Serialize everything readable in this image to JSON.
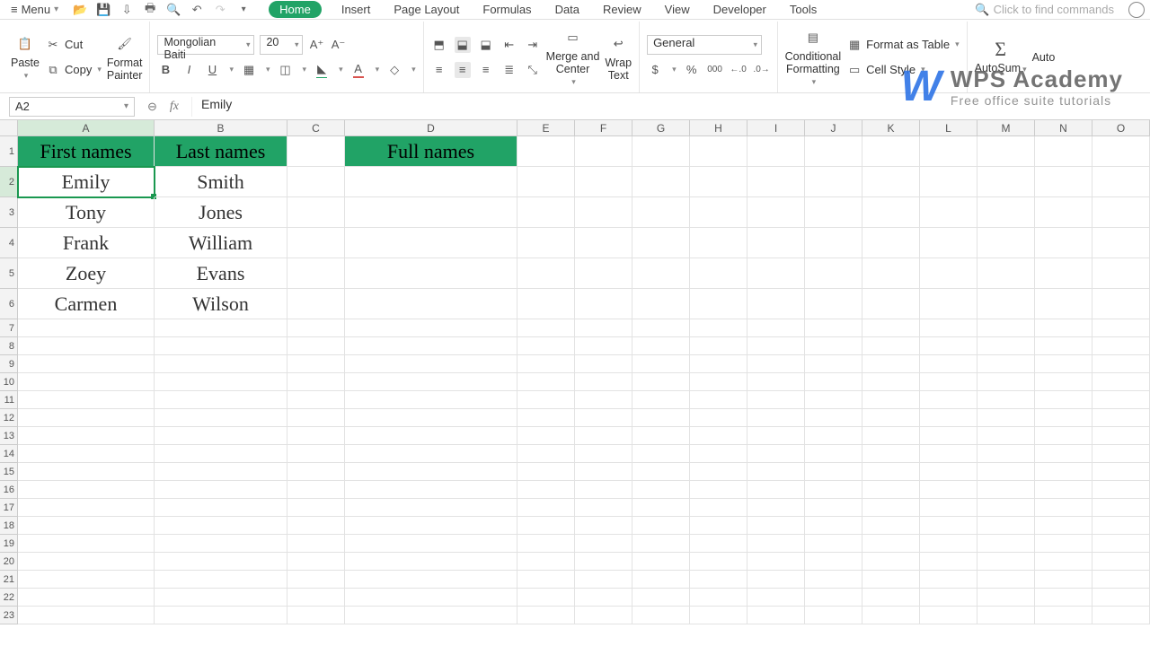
{
  "menu_label": "Menu",
  "tabs": {
    "home": "Home",
    "insert": "Insert",
    "page_layout": "Page Layout",
    "formulas": "Formulas",
    "data": "Data",
    "review": "Review",
    "view": "View",
    "developer": "Developer",
    "tools": "Tools"
  },
  "search_placeholder": "Click to find commands",
  "ribbon": {
    "paste": "Paste",
    "cut": "Cut",
    "copy": "Copy",
    "format_painter": "Format\nPainter",
    "font_name": "Mongolian Baiti",
    "font_size": "20",
    "merge_center": "Merge and\nCenter",
    "wrap_text": "Wrap\nText",
    "number_format": "General",
    "conditional_formatting": "Conditional\nFormatting",
    "format_as_table": "Format as Table",
    "cell_style": "Cell Style",
    "autosum": "AutoSum",
    "auto_partial": "Auto"
  },
  "name_box": "A2",
  "formula_value": "Emily",
  "columns": [
    {
      "id": "A",
      "w": 152
    },
    {
      "id": "B",
      "w": 148
    },
    {
      "id": "C",
      "w": 64
    },
    {
      "id": "D",
      "w": 192
    },
    {
      "id": "E",
      "w": 64
    },
    {
      "id": "F",
      "w": 64
    },
    {
      "id": "G",
      "w": 64
    },
    {
      "id": "H",
      "w": 64
    },
    {
      "id": "I",
      "w": 64
    },
    {
      "id": "J",
      "w": 64
    },
    {
      "id": "K",
      "w": 64
    },
    {
      "id": "L",
      "w": 64
    },
    {
      "id": "M",
      "w": 64
    },
    {
      "id": "N",
      "w": 64
    },
    {
      "id": "O",
      "w": 64
    }
  ],
  "row_heights": {
    "tall_rows": 6,
    "tall_h": 34,
    "short_h": 20,
    "total_rows": 23
  },
  "cells": {
    "A1": "First names",
    "B1": "Last names",
    "D1": "Full names",
    "A2": "Emily",
    "B2": "Smith",
    "A3": "Tony",
    "B3": "Jones",
    "A4": "Frank",
    "B4": "William",
    "A5": "Zoey",
    "B5": "Evans",
    "A6": "Carmen",
    "B6": "Wilson"
  },
  "watermark": {
    "brand": "WPS Academy",
    "tagline": "Free office suite tutorials",
    "logo": "W"
  }
}
